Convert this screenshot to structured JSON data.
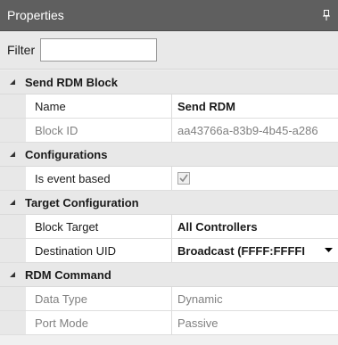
{
  "panel": {
    "title": "Properties"
  },
  "filter": {
    "label": "Filter",
    "value": "",
    "placeholder": ""
  },
  "sections": [
    {
      "title": "Send RDM Block",
      "rows": [
        {
          "label": "Name",
          "value": "Send RDM"
        },
        {
          "label": "Block ID",
          "value": "aa43766a-83b9-4b45-a286"
        }
      ]
    },
    {
      "title": "Configurations",
      "rows": [
        {
          "label": "Is event based",
          "checked": true
        }
      ]
    },
    {
      "title": "Target Configuration",
      "rows": [
        {
          "label": "Block Target",
          "value": "All Controllers"
        },
        {
          "label": "Destination UID",
          "value": "Broadcast (FFFF:FFFFI"
        }
      ]
    },
    {
      "title": "RDM Command",
      "rows": [
        {
          "label": "Data Type",
          "value": "Dynamic"
        },
        {
          "label": "Port Mode",
          "value": "Passive"
        }
      ]
    }
  ],
  "colors": {
    "titlebar": "#5f5f5f",
    "category_bg": "#e8e8e8",
    "muted_text": "#808080"
  }
}
